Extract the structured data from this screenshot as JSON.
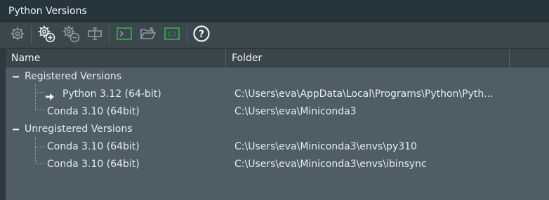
{
  "window": {
    "title": "Python Versions"
  },
  "toolbar": {
    "buttons": [
      {
        "icon": "gear-icon"
      },
      {
        "icon": "gear-add-icon"
      },
      {
        "icon": "gear-remove-icon"
      },
      {
        "icon": "rename-icon"
      },
      {
        "icon": "terminal-icon"
      },
      {
        "icon": "open-folder-icon"
      },
      {
        "icon": "cmd-console-icon",
        "text": "C:\\"
      },
      {
        "icon": "help-icon",
        "text": "?"
      }
    ]
  },
  "columns": {
    "name": "Name",
    "folder": "Folder"
  },
  "tree": {
    "registered": {
      "label": "Registered Versions",
      "items": [
        {
          "name": "Python 3.12 (64-bit)",
          "folder": "C:\\Users\\eva\\AppData\\Local\\Programs\\Python\\Pyth...",
          "active": true
        },
        {
          "name": "Conda 3.10 (64bit)",
          "folder": "C:\\Users\\eva\\Miniconda3",
          "active": false
        }
      ]
    },
    "unregistered": {
      "label": "Unregistered Versions",
      "items": [
        {
          "name": "Conda 3.10 (64bit)",
          "folder": "C:\\Users\\eva\\Miniconda3\\envs\\py310"
        },
        {
          "name": "Conda 3.10 (64bit)",
          "folder": "C:\\Users\\eva\\Miniconda3\\envs\\ibinsync"
        }
      ]
    }
  },
  "colors": {
    "background": "#2f3a40",
    "panel": "#4f5d66",
    "accent_green": "#36b04a"
  }
}
